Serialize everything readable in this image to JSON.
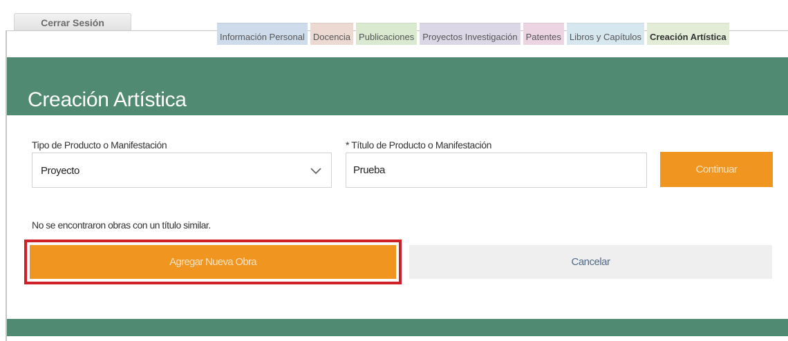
{
  "header": {
    "logout_label": "Cerrar Sesión"
  },
  "tabs": [
    {
      "label": "Información Personal",
      "color": "#cddbeb",
      "active": false
    },
    {
      "label": "Docencia",
      "color": "#ecd9d2",
      "active": false
    },
    {
      "label": "Publicaciones",
      "color": "#d9ead0",
      "active": false
    },
    {
      "label": "Proyectos Investigación",
      "color": "#dcd7e7",
      "active": false
    },
    {
      "label": "Patentes",
      "color": "#ecd4e3",
      "active": false
    },
    {
      "label": "Libros y Capítulos",
      "color": "#d6e7f0",
      "active": false
    },
    {
      "label": "Creación Artística",
      "color": "#e2ecd6",
      "active": true
    }
  ],
  "section": {
    "title": "Creación Artística"
  },
  "form": {
    "product_type_label": "Tipo de Producto o Manifestación",
    "product_type_value": "Proyecto",
    "title_label": "* Título de Producto o Manifestación",
    "title_value": "Prueba",
    "continue_label": "Continuar",
    "no_results_text": "No se encontraron obras con un título similar.",
    "add_work_label": "Agregar Nueva Obra",
    "cancel_label": "Cancelar"
  },
  "colors": {
    "brand_green": "#508a73",
    "accent_orange": "#f0951f",
    "highlight_red": "#cf2028"
  }
}
